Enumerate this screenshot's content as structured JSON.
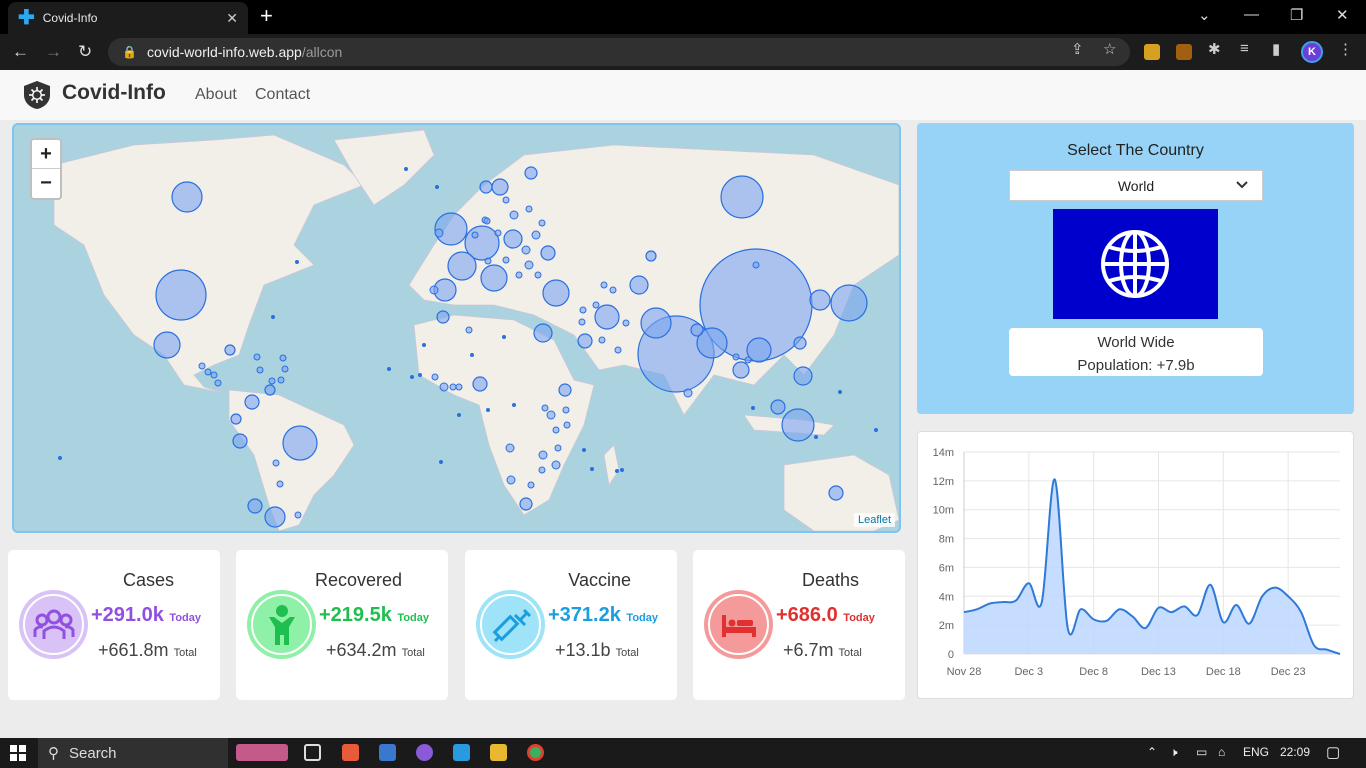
{
  "browser": {
    "tab_title": "Covid-Info",
    "tab_close": "✕",
    "new_tab": "+",
    "url_host": "covid-world-info.web.app",
    "url_path": "/allcon"
  },
  "site": {
    "brand": "Covid-Info",
    "nav": [
      "About",
      "Contact"
    ]
  },
  "map": {
    "zoom_in": "+",
    "zoom_out": "−",
    "attribution": "Leaflet"
  },
  "selector": {
    "label": "Select The Country",
    "selected": "World",
    "region_name": "World Wide",
    "population": "Population: +7.9b"
  },
  "stats": [
    {
      "label": "Cases",
      "today": "+291.0k",
      "today_suffix": "Today",
      "total": "+661.8m",
      "total_suffix": "Total",
      "color": "#9150e0",
      "bg": "#d9c2f5",
      "icon": "group-icon"
    },
    {
      "label": "Recovered",
      "today": "+219.5k",
      "today_suffix": "Today",
      "total": "+634.2m",
      "total_suffix": "Total",
      "color": "#1fbf4f",
      "bg": "#8ff0a7",
      "icon": "person-icon"
    },
    {
      "label": "Vaccine",
      "today": "+371.2k",
      "today_suffix": "Today",
      "total": "+13.1b",
      "total_suffix": "Total",
      "color": "#1a9ee0",
      "bg": "#9ee3f7",
      "icon": "syringe-icon"
    },
    {
      "label": "Deaths",
      "today": "+686.0",
      "today_suffix": "Today",
      "total": "+6.7m",
      "total_suffix": "Total",
      "color": "#e03030",
      "bg": "#f49a9a",
      "icon": "bed-icon"
    }
  ],
  "chart_data": {
    "type": "area",
    "x_ticks": [
      "Nov 28",
      "Dec 3",
      "Dec 8",
      "Dec 13",
      "Dec 18",
      "Dec 23"
    ],
    "y_ticks": [
      "0",
      "2m",
      "4m",
      "6m",
      "8m",
      "10m",
      "12m",
      "14m"
    ],
    "ylim": [
      0,
      14
    ],
    "series": [
      {
        "values": [
          2.9,
          3.1,
          3.5,
          3.6,
          3.7,
          4.9,
          3.6,
          12.1,
          1.8,
          3.1,
          2.4,
          2.3,
          3.1,
          2.6,
          1.8,
          3.2,
          2.9,
          3.3,
          2.7,
          4.8,
          2.2,
          3.4,
          2.1,
          4.0,
          4.6,
          4.0,
          2.9,
          0.6,
          0.3,
          0.0
        ],
        "fill": "#bdd7ff",
        "stroke": "#2e7ad6"
      }
    ]
  },
  "taskbar": {
    "search": "Search",
    "lang": "ENG",
    "time": "22:09"
  }
}
